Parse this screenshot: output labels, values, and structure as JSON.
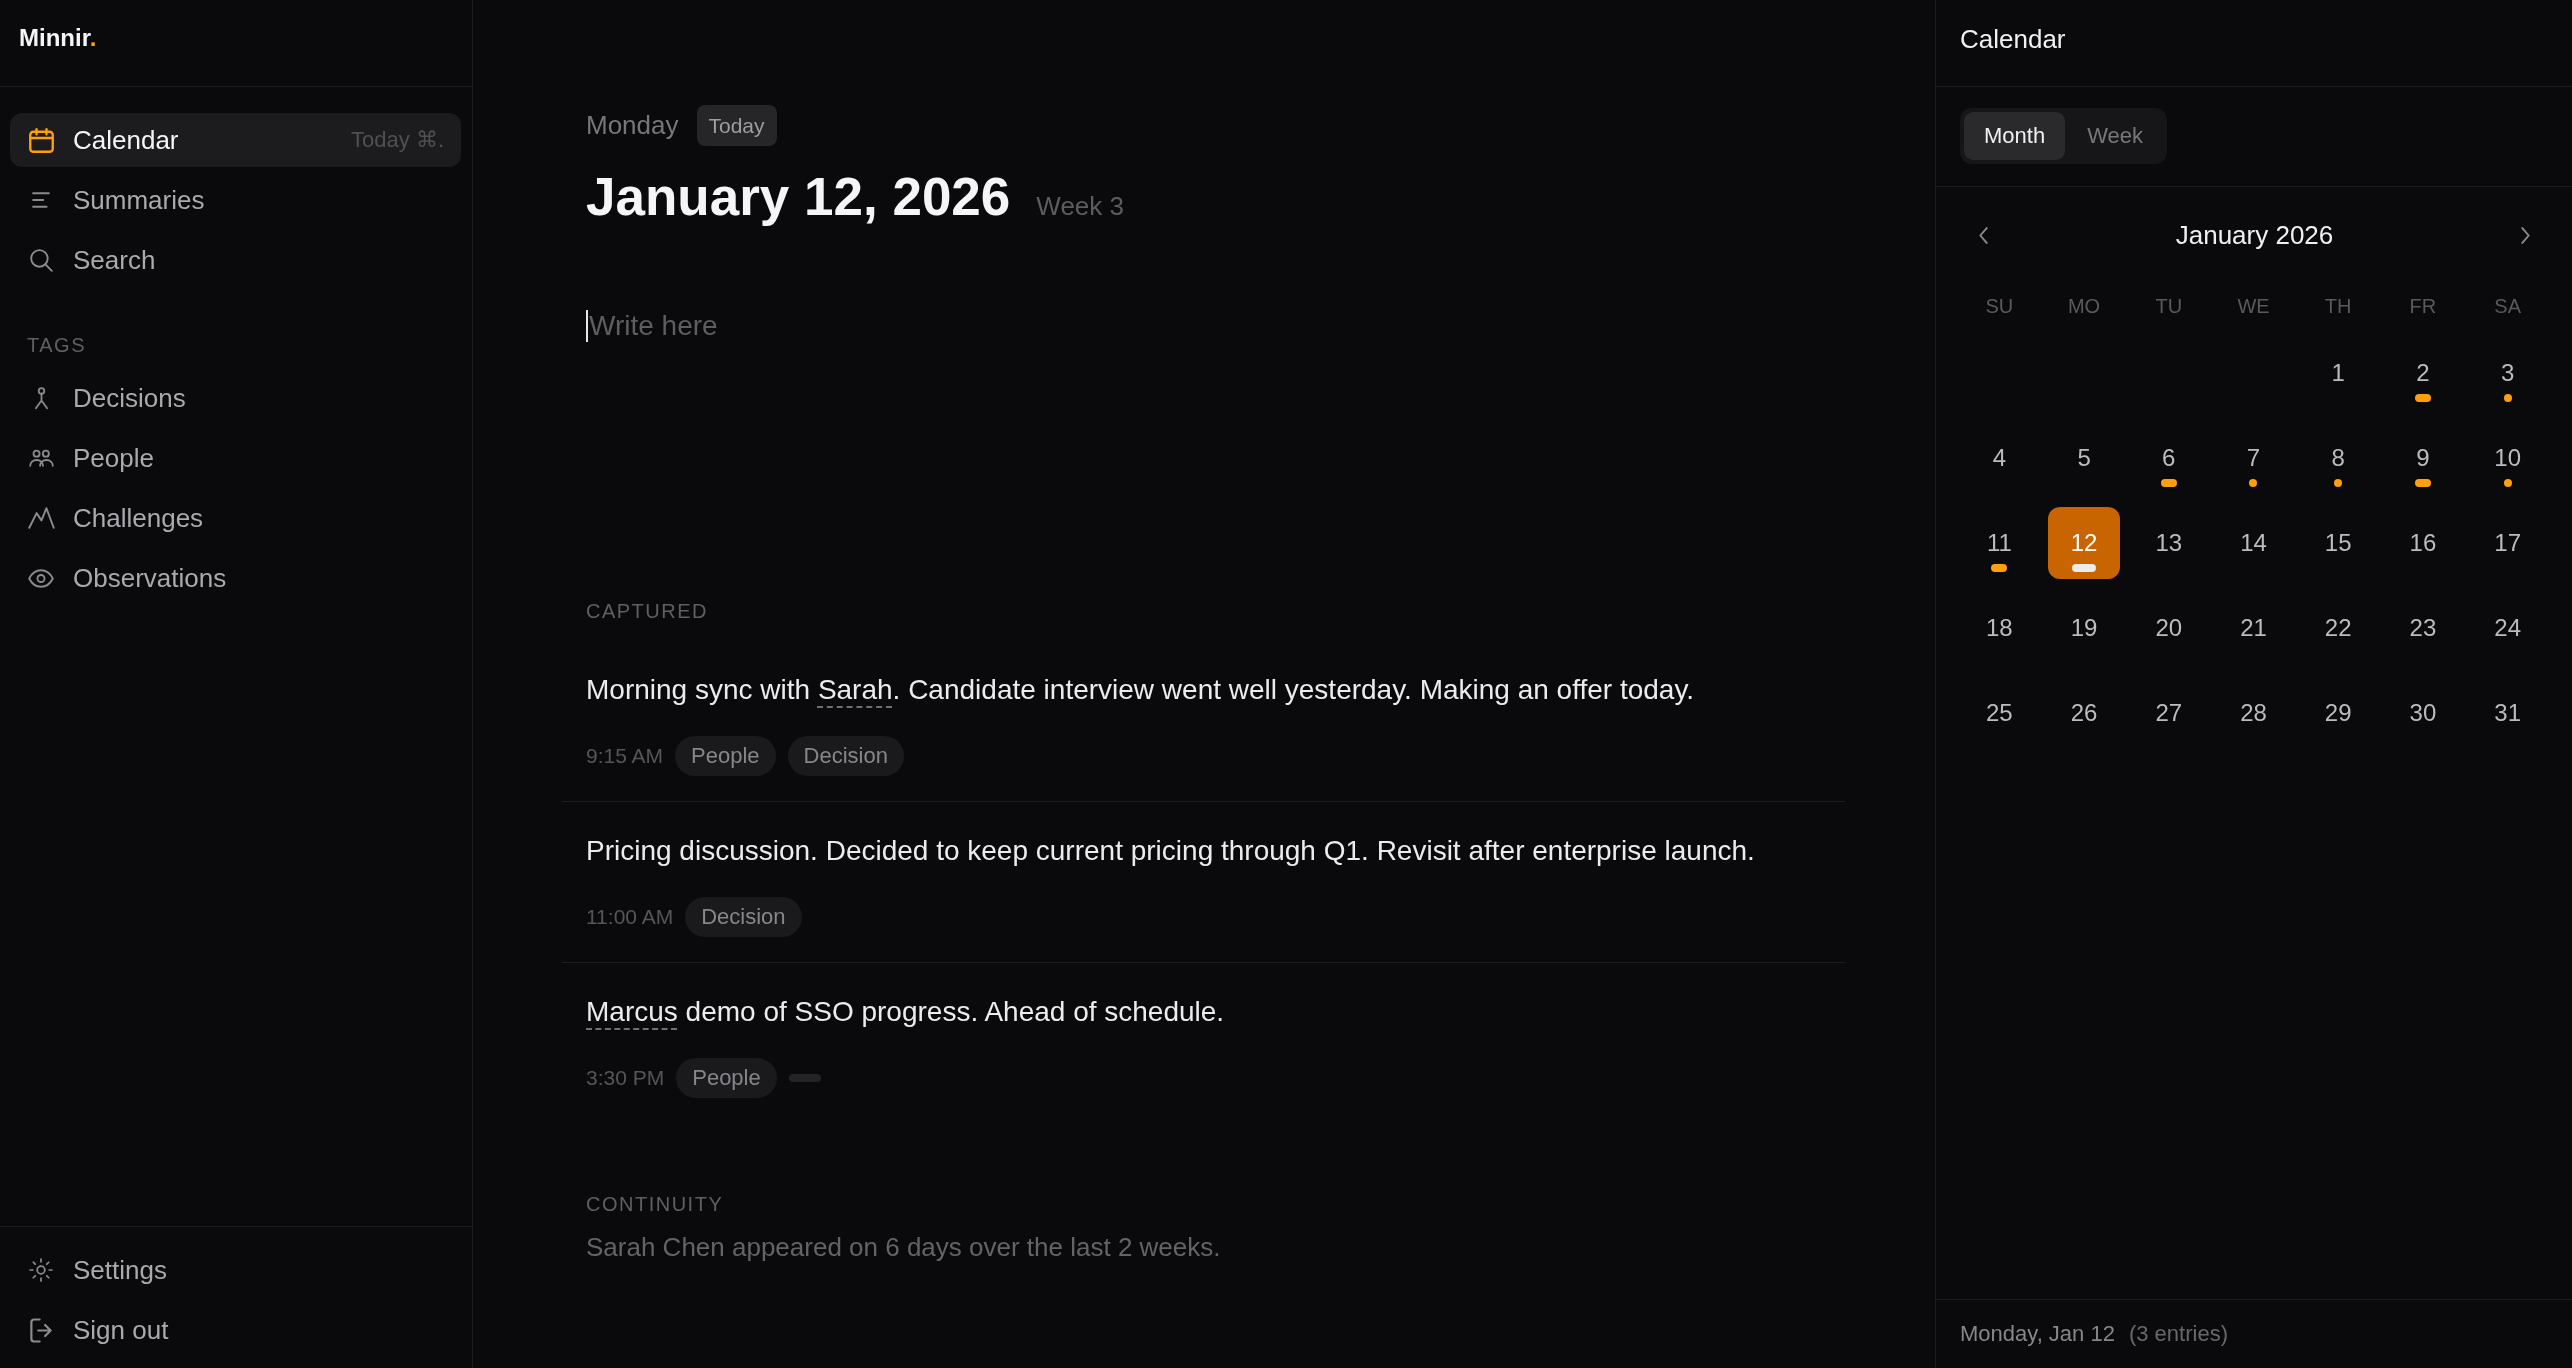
{
  "sidebar": {
    "logo": {
      "text": "Minnir",
      "accent": "."
    },
    "nav": [
      {
        "label": "Calendar",
        "hint": "Today ⌘.",
        "selected": true
      },
      {
        "label": "Summaries",
        "selected": false
      },
      {
        "label": "Search",
        "selected": false
      }
    ],
    "tags_heading": "TAGS",
    "tags": [
      {
        "label": "Decisions",
        "selected": false
      },
      {
        "label": "People",
        "selected": false
      },
      {
        "label": "Challenges",
        "selected": false
      },
      {
        "label": "Observations",
        "selected": false
      }
    ],
    "footer": [
      {
        "label": "Settings"
      },
      {
        "label": "Sign out"
      }
    ]
  },
  "journal": {
    "weekday": "Monday",
    "badge": "Today",
    "date": "January 12, 2026",
    "week": "Week 3",
    "editor": {
      "placeholder": "Write here",
      "focused": true
    },
    "captured_heading": "CAPTURED",
    "entries": [
      {
        "segments": [
          {
            "kind": "text",
            "text": "Morning sync with "
          },
          {
            "kind": "mention",
            "text": "Sarah"
          },
          {
            "kind": "text",
            "text": ". Candidate interview went well yesterday. Making an offer today."
          }
        ],
        "time": "9:15 AM",
        "tags": [
          "People",
          "Decision"
        ],
        "loading_tag": false
      },
      {
        "segments": [
          {
            "kind": "text",
            "text": "Pricing discussion. Decided to keep current pricing through Q1. Revisit after enterprise launch."
          }
        ],
        "time": "11:00 AM",
        "tags": [
          "Decision"
        ],
        "loading_tag": false
      },
      {
        "segments": [
          {
            "kind": "mention",
            "text": "Marcus"
          },
          {
            "kind": "text",
            "text": " demo of SSO progress. Ahead of schedule."
          }
        ],
        "time": "3:30 PM",
        "tags": [
          "People"
        ],
        "loading_tag": true
      }
    ],
    "continuity": {
      "heading": "CONTINUITY",
      "text": "Sarah Chen appeared on 6 days over the last 2 weeks."
    }
  },
  "calendar": {
    "title": "Calendar",
    "views": [
      {
        "label": "Month",
        "selected": true
      },
      {
        "label": "Week",
        "selected": false
      }
    ],
    "month": "January 2026",
    "weekdays": [
      "SU",
      "MO",
      "TU",
      "WE",
      "TH",
      "FR",
      "SA"
    ],
    "weeks": [
      {
        "days": [
          {
            "day": "1",
            "kind": "plain",
            "selected": false
          },
          {
            "day": "2",
            "kind": "bar",
            "selected": false
          },
          {
            "day": "3",
            "kind": "dot",
            "selected": false
          }
        ]
      },
      {
        "days": [
          {
            "day": "4",
            "kind": "plain",
            "selected": false
          },
          {
            "day": "5",
            "kind": "plain",
            "selected": false
          },
          {
            "day": "6",
            "kind": "bar",
            "selected": false
          },
          {
            "day": "7",
            "kind": "dot",
            "selected": false
          },
          {
            "day": "8",
            "kind": "dot",
            "selected": false
          },
          {
            "day": "9",
            "kind": "bar",
            "selected": false
          },
          {
            "day": "10",
            "kind": "dot",
            "selected": false
          }
        ]
      },
      {
        "days": [
          {
            "day": "11",
            "kind": "bar",
            "selected": false
          },
          {
            "day": "12",
            "kind": "wide",
            "selected": true
          },
          {
            "day": "13",
            "kind": "plain",
            "selected": false
          },
          {
            "day": "14",
            "kind": "plain",
            "selected": false
          },
          {
            "day": "15",
            "kind": "plain",
            "selected": false
          },
          {
            "day": "16",
            "kind": "plain",
            "selected": false
          },
          {
            "day": "17",
            "kind": "plain",
            "selected": false
          }
        ]
      },
      {
        "days": [
          {
            "day": "18",
            "kind": "plain",
            "selected": false
          },
          {
            "day": "19",
            "kind": "plain",
            "selected": false
          },
          {
            "day": "20",
            "kind": "plain",
            "selected": false
          },
          {
            "day": "21",
            "kind": "plain",
            "selected": false
          },
          {
            "day": "22",
            "kind": "plain",
            "selected": false
          },
          {
            "day": "23",
            "kind": "plain",
            "selected": false
          },
          {
            "day": "24",
            "kind": "plain",
            "selected": false
          }
        ]
      },
      {
        "days": [
          {
            "day": "25",
            "kind": "plain",
            "selected": false
          },
          {
            "day": "26",
            "kind": "plain",
            "selected": false
          },
          {
            "day": "27",
            "kind": "plain",
            "selected": false
          },
          {
            "day": "28",
            "kind": "plain",
            "selected": false
          },
          {
            "day": "29",
            "kind": "plain",
            "selected": false
          },
          {
            "day": "30",
            "kind": "plain",
            "selected": false
          },
          {
            "day": "31",
            "kind": "plain",
            "selected": false
          }
        ]
      }
    ],
    "footer": {
      "date": "Monday, Jan 12",
      "count": "(3 entries)"
    }
  }
}
